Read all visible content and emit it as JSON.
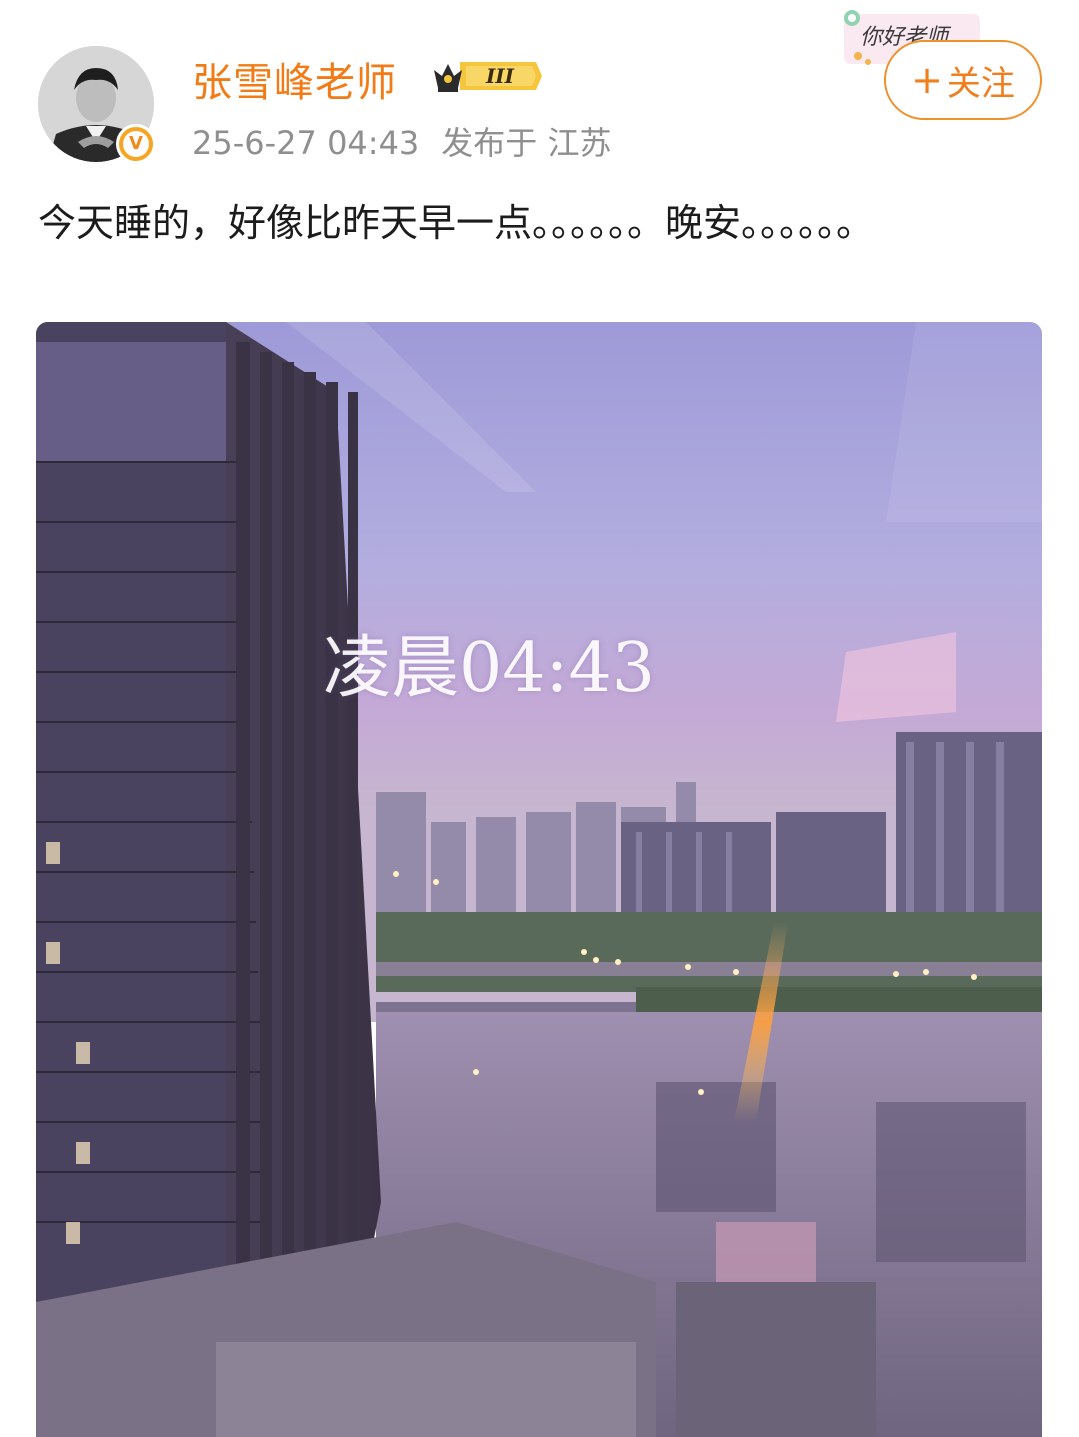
{
  "author": {
    "name": "张雪峰老师",
    "vip_level": "III",
    "verified_mark": "V"
  },
  "meta": {
    "timestamp": "25-6-27 04:43",
    "location": "发布于 江苏"
  },
  "sticker": {
    "text": "你好老师"
  },
  "follow_button": {
    "plus": "+",
    "label": "关注"
  },
  "post": {
    "text": "今天睡的，好像比昨天早一点。。。。。。晚安。。。。。。"
  },
  "photo": {
    "caption": "凌晨04:43"
  },
  "colors": {
    "accent": "#f27b16",
    "meta_gray": "#8f8f8f",
    "follow_border": "#f0902b"
  }
}
